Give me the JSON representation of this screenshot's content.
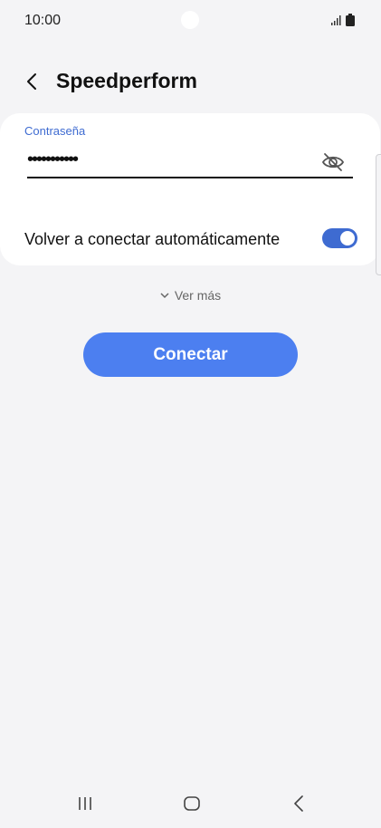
{
  "status_bar": {
    "time": "10:00",
    "icons": [
      "signal-icon",
      "battery-icon"
    ]
  },
  "header": {
    "title": "Speedperform",
    "back_icon": "chevron-left-icon"
  },
  "password_field": {
    "label": "Contraseña",
    "value": "•••••••••••",
    "toggle_visibility_icon": "eye-off-icon"
  },
  "auto_reconnect": {
    "label": "Volver a conectar automáticamente",
    "enabled": true
  },
  "see_more": {
    "label": "Ver más",
    "icon": "chevron-down-icon"
  },
  "connect_button": {
    "label": "Conectar"
  },
  "nav_bar": {
    "recent_icon": "recent-apps-icon",
    "home_icon": "home-icon",
    "back_icon": "back-icon"
  },
  "colors": {
    "accent": "#3e6bd1",
    "button": "#4c7ff0",
    "background": "#f4f4f6",
    "card": "#ffffff"
  }
}
